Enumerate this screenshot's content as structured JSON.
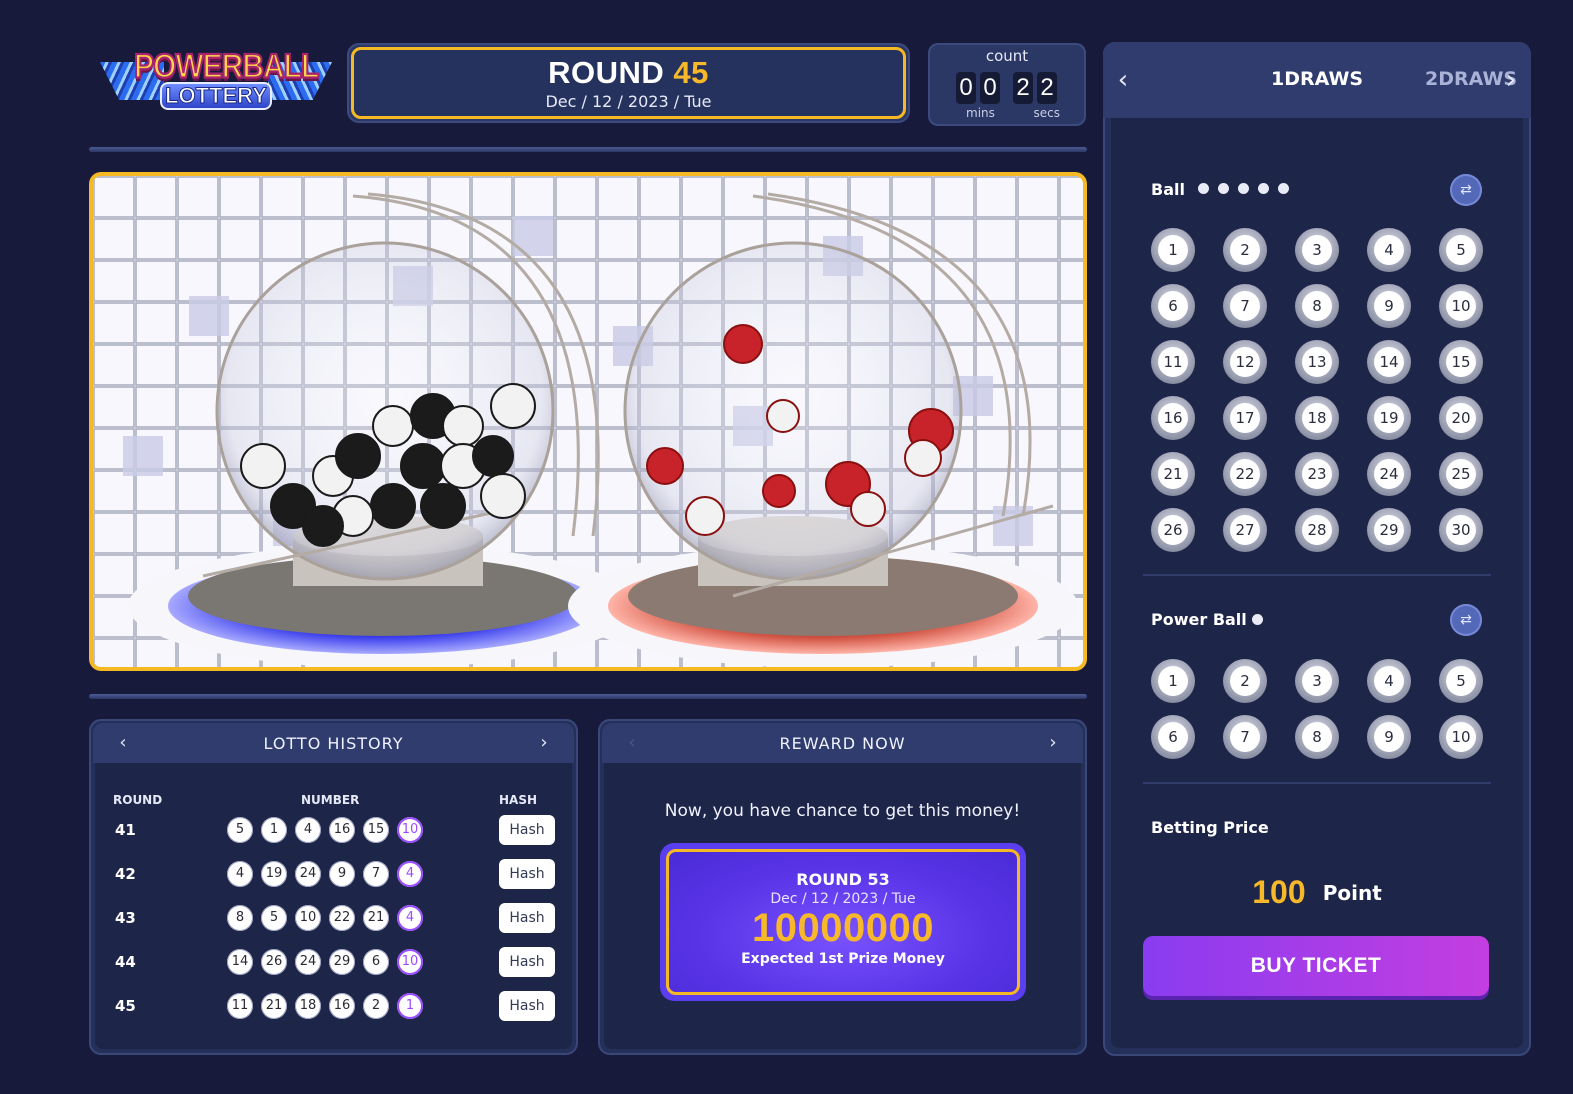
{
  "logo": {
    "line1": "POWERBALL",
    "line2": "LOTTERY"
  },
  "round": {
    "label": "ROUND",
    "number": "45",
    "date": "Dec / 12 / 2023 / Tue"
  },
  "countdown": {
    "label": "count",
    "digits": [
      "0",
      "0",
      "2",
      "2"
    ],
    "mins_label": "mins",
    "secs_label": "secs"
  },
  "history": {
    "title": "LOTTO HISTORY",
    "columns": [
      "ROUND",
      "NUMBER",
      "HASH"
    ],
    "rows": [
      {
        "round": "41",
        "balls": [
          "5",
          "1",
          "4",
          "16",
          "15"
        ],
        "power": "10",
        "hash": "Hash"
      },
      {
        "round": "42",
        "balls": [
          "4",
          "19",
          "24",
          "9",
          "7"
        ],
        "power": "4",
        "hash": "Hash"
      },
      {
        "round": "43",
        "balls": [
          "8",
          "5",
          "10",
          "22",
          "21"
        ],
        "power": "4",
        "hash": "Hash"
      },
      {
        "round": "44",
        "balls": [
          "14",
          "26",
          "24",
          "29",
          "6"
        ],
        "power": "10",
        "hash": "Hash"
      },
      {
        "round": "45",
        "balls": [
          "11",
          "21",
          "18",
          "16",
          "2"
        ],
        "power": "1",
        "hash": "Hash"
      }
    ]
  },
  "reward": {
    "title": "REWARD NOW",
    "message": "Now, you have chance to get this money!",
    "round": "ROUND 53",
    "date": "Dec / 12 / 2023 / Tue",
    "amount": "10000000",
    "caption": "Expected 1st Prize Money"
  },
  "side": {
    "tab_active": "1DRAWS",
    "tab_next": "2DRAWS",
    "ball_label": "Ball",
    "ball_pick_count": 5,
    "balls": [
      "1",
      "2",
      "3",
      "4",
      "5",
      "6",
      "7",
      "8",
      "9",
      "10",
      "11",
      "12",
      "13",
      "14",
      "15",
      "16",
      "17",
      "18",
      "19",
      "20",
      "21",
      "22",
      "23",
      "24",
      "25",
      "26",
      "27",
      "28",
      "29",
      "30"
    ],
    "power_label": "Power Ball",
    "power_pick_count": 1,
    "power_balls": [
      "1",
      "2",
      "3",
      "4",
      "5",
      "6",
      "7",
      "8",
      "9",
      "10"
    ],
    "price_label": "Betting Price",
    "price_value": "100",
    "price_unit": "Point",
    "buy_label": "BUY TICKET"
  },
  "colors": {
    "accent_gold": "#f5b923",
    "purple": "#9b4cff",
    "background": "#171a3a"
  },
  "icons": [
    "chevron-left-icon",
    "chevron-right-icon",
    "shuffle-icon"
  ]
}
